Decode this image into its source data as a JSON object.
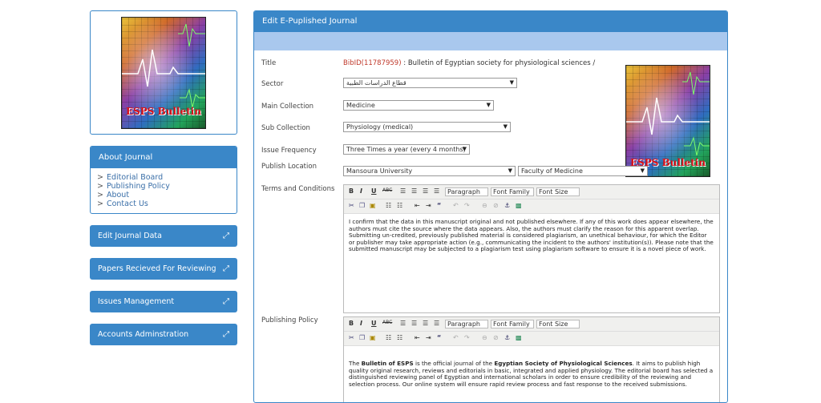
{
  "sidebar": {
    "cover_title": "ESPS Bulletin",
    "about": {
      "heading": "About Journal",
      "items": [
        {
          "label": "Editorial Board"
        },
        {
          "label": "Publishing Policy"
        },
        {
          "label": "About"
        },
        {
          "label": "Contact Us"
        }
      ]
    },
    "nav": [
      {
        "label": "Edit Journal Data"
      },
      {
        "label": "Papers Recieved For Reviewing"
      },
      {
        "label": "Issues Management"
      },
      {
        "label": "Accounts Adminstration"
      }
    ]
  },
  "main": {
    "heading": "Edit E-Puplished Journal",
    "fields": {
      "title_label": "Title",
      "title_bibid": "BibID(11787959)",
      "title_text": " : Bulletin of Egyptian society for physiological sciences /",
      "sector_label": "Sector",
      "sector_value": "قطاع الدراسات الطبية",
      "main_collection_label": "Main Collection",
      "main_collection_value": "Medicine",
      "sub_collection_label": "Sub Collection",
      "sub_collection_value": "Physiology (medical)",
      "issue_frequency_label": "Issue Frequency",
      "issue_frequency_value": "Three Times a year (every 4 months)",
      "publish_location_label": "Publish Location",
      "university_value": "Mansoura University",
      "faculty_value": "Faculty of Medicine",
      "terms_label": "Terms and Conditions",
      "policy_label": "Publishing Policy"
    },
    "editor_toolbar": {
      "bold": "B",
      "italic": "I",
      "underline": "U",
      "strike": "ABC",
      "format": "Paragraph",
      "font_family": "Font Family",
      "font_size": "Font Size"
    },
    "terms_text": "I confirm that  the data in this manuscript original and not published elsewhere.  If any of this work does appear elsewhere, the authors must cite the source where the data appears. Also, the authors must clarify the reason for this apparent overlap. Submitting un-credited, previously published material is considered plagiarism, an unethical behaviour, for which the Editor or publisher may take appropriate action (e.g., communicating the incident to the authors' institution(s)). Please note that the submitted manuscript may be subjected to a plagiarism test using plagiarism software to ensure it is a novel piece of work.",
    "policy": {
      "t1": "The ",
      "b1": "Bulletin of ESPS",
      "t2": " is the official journal of the ",
      "b2": "Egyptian Society of Physiological Sciences",
      "t3": ". It aims to publish high quality original research, reviews and editorials in basic, integrated and applied physiology. The editorial board has selected a distinguished reviewing panel of Egyptian and international scholars in order to ensure credibility of the reviewing and selection process. Our online system will ensure rapid review process and fast response to the received submissions."
    }
  }
}
